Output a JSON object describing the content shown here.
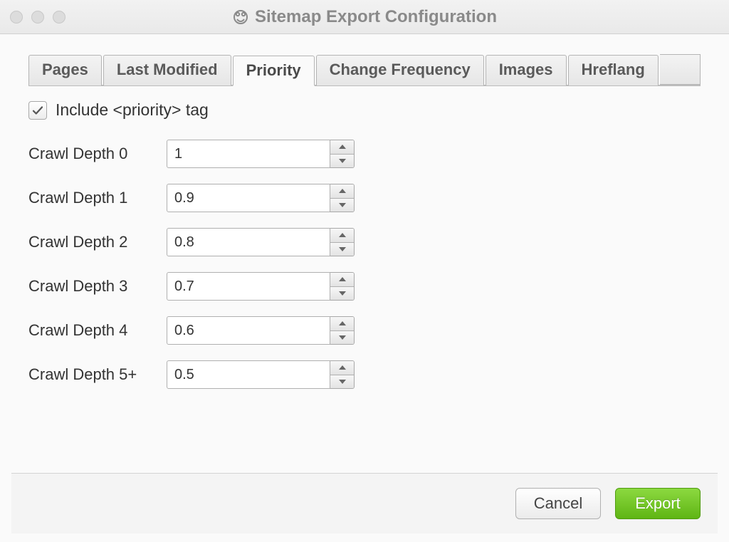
{
  "window": {
    "title": "Sitemap Export Configuration"
  },
  "tabs": {
    "items": [
      {
        "label": "Pages"
      },
      {
        "label": "Last Modified"
      },
      {
        "label": "Priority"
      },
      {
        "label": "Change Frequency"
      },
      {
        "label": "Images"
      },
      {
        "label": "Hreflang"
      }
    ],
    "active_index": 2
  },
  "priority_panel": {
    "include_checkbox_label": "Include <priority> tag",
    "include_checked": true,
    "rows": [
      {
        "label": "Crawl Depth 0",
        "value": "1"
      },
      {
        "label": "Crawl Depth 1",
        "value": "0.9"
      },
      {
        "label": "Crawl Depth 2",
        "value": "0.8"
      },
      {
        "label": "Crawl Depth 3",
        "value": "0.7"
      },
      {
        "label": "Crawl Depth 4",
        "value": "0.6"
      },
      {
        "label": "Crawl Depth 5+",
        "value": "0.5"
      }
    ]
  },
  "footer": {
    "cancel_label": "Cancel",
    "export_label": "Export"
  }
}
